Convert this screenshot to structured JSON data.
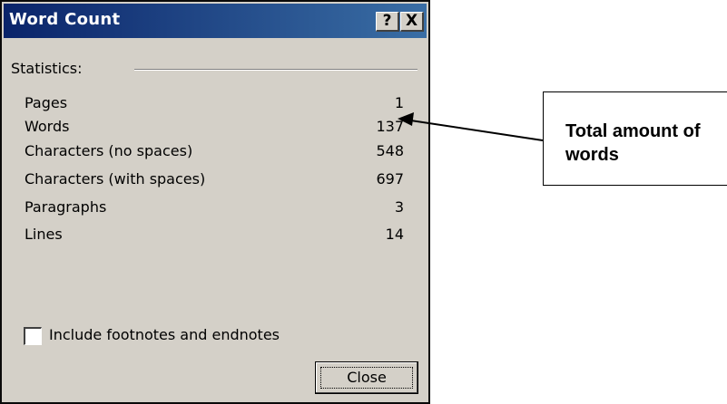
{
  "dialog": {
    "title": "Word Count",
    "help_button": "?",
    "close_icon_label": "X",
    "group_label": "Statistics:",
    "stats": [
      {
        "label": "Pages",
        "value": "1"
      },
      {
        "label": "Words",
        "value": "137"
      },
      {
        "label": "Characters (no spaces)",
        "value": "548"
      },
      {
        "label": "Characters (with spaces)",
        "value": "697"
      },
      {
        "label": "Paragraphs",
        "value": "3"
      },
      {
        "label": "Lines",
        "value": "14"
      }
    ],
    "checkbox_label": "Include footnotes and endnotes",
    "checkbox_checked": false,
    "close_button": "Close"
  },
  "callout": {
    "text": "Total amount of words"
  },
  "colors": {
    "titlebar_start": "#0a246a",
    "titlebar_end": "#3a6ea5",
    "dialog_bg": "#d4d0c8"
  }
}
